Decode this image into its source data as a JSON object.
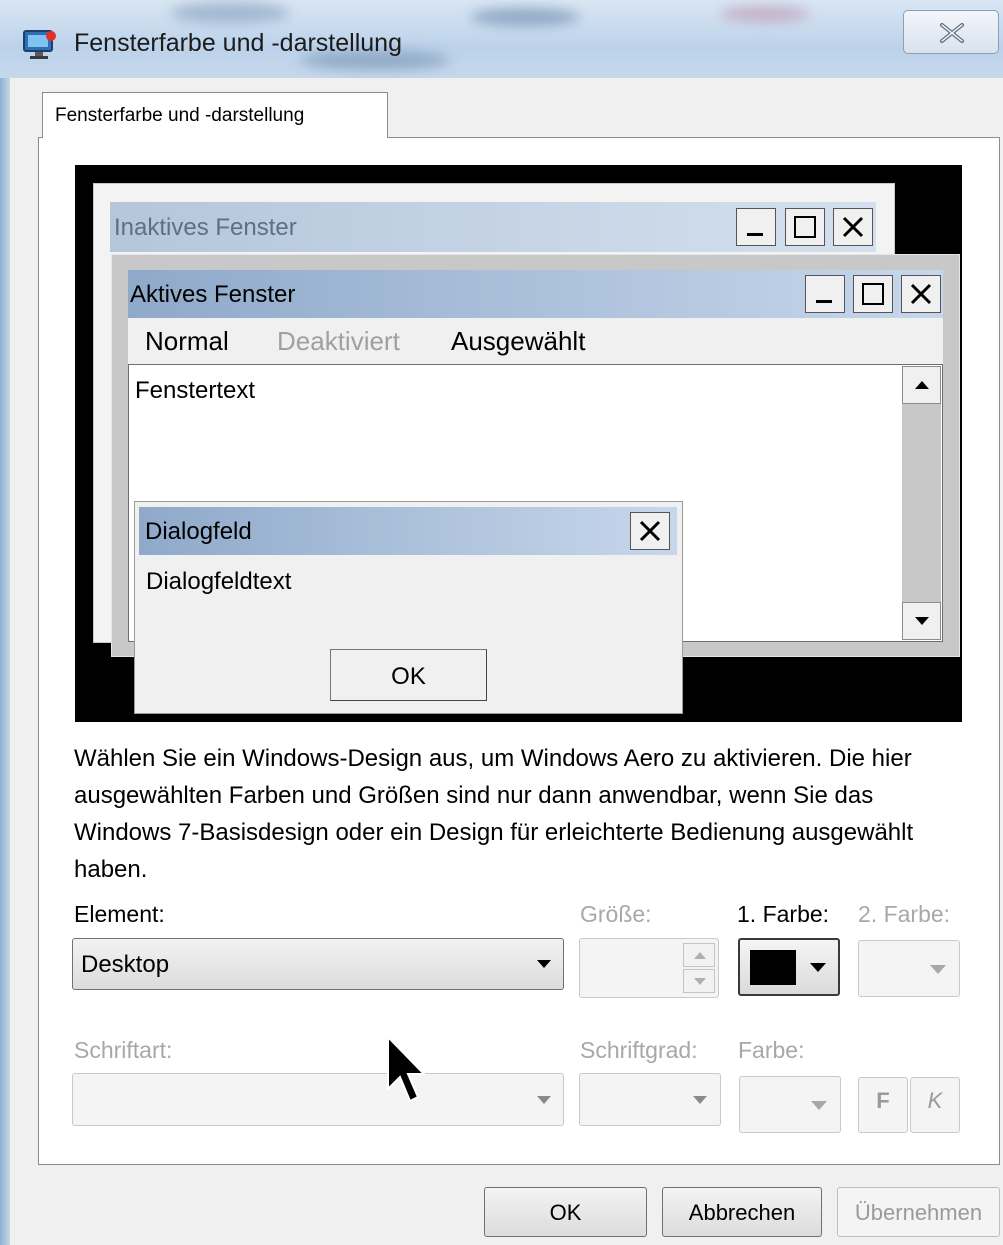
{
  "window": {
    "title": "Fensterfarbe und -darstellung",
    "close_icon": "close-icon"
  },
  "tabs": [
    {
      "label": "Fensterfarbe und -darstellung"
    }
  ],
  "preview": {
    "inactive_title": "Inaktives Fenster",
    "active_title": "Aktives Fenster",
    "menu": {
      "normal": "Normal",
      "disabled": "Deaktiviert",
      "selected": "Ausgewählt"
    },
    "window_text": "Fenstertext",
    "dialog_title": "Dialogfeld",
    "dialog_text": "Dialogfeldtext",
    "dialog_ok": "OK"
  },
  "description": "Wählen Sie ein Windows-Design aus, um Windows Aero zu aktivieren. Die hier ausgewählten Farben und Größen sind nur dann anwendbar, wenn Sie das Windows 7-Basisdesign oder ein Design für erleichterte Bedienung ausgewählt haben.",
  "element": {
    "label": "Element:",
    "value": "Desktop"
  },
  "size": {
    "label": "Größe:",
    "value": ""
  },
  "color1": {
    "label": "1. Farbe:",
    "value": "#000000"
  },
  "color2": {
    "label": "2. Farbe:"
  },
  "font": {
    "label": "Schriftart:",
    "value": ""
  },
  "font_size": {
    "label": "Schriftgrad:",
    "value": ""
  },
  "font_color": {
    "label": "Farbe:"
  },
  "bold_label": "F",
  "italic_label": "K",
  "buttons": {
    "ok": "OK",
    "cancel": "Abbrechen",
    "apply": "Übernehmen"
  },
  "colors": {
    "title_active": "#8fa9ca",
    "title_inactive": "#b5c6db",
    "preview_bg": "#000000"
  }
}
